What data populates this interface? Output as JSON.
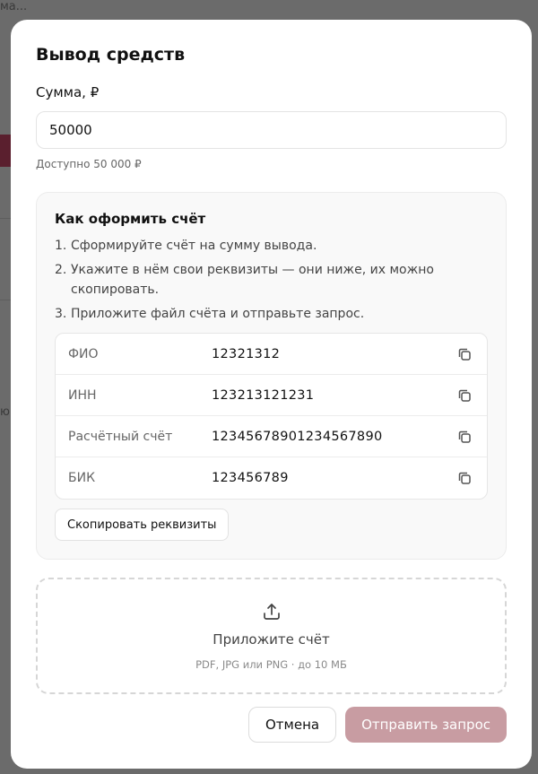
{
  "background": {
    "fragment_top": "ма...",
    "fragment_mid": "ю"
  },
  "modal": {
    "title": "Вывод средств",
    "amount": {
      "label": "Сумма, ₽",
      "value": "50000",
      "available": "Доступно 50 000 ₽"
    },
    "instructions": {
      "title": "Как оформить счёт",
      "steps": [
        {
          "num": "1.",
          "text": "Сформируйте счёт на сумму вывода."
        },
        {
          "num": "2.",
          "text": "Укажите в нём свои реквизиты — они ниже, их можно скопировать."
        },
        {
          "num": "3.",
          "text": "Приложите файл счёта и отправьте запрос."
        }
      ],
      "requisites": [
        {
          "label": "ФИО",
          "value": "12321312"
        },
        {
          "label": "ИНН",
          "value": "123213121231"
        },
        {
          "label": "Расчётный счёт",
          "value": "12345678901234567890"
        },
        {
          "label": "БИК",
          "value": "123456789"
        }
      ],
      "copy_all_label": "Скопировать реквизиты"
    },
    "upload": {
      "icon": "upload-icon",
      "title": "Приложите счёт",
      "hint": "PDF, JPG или PNG · до 10 МБ"
    },
    "actions": {
      "cancel_label": "Отмена",
      "submit_label": "Отправить запрос",
      "submit_color": "#c89ca2"
    }
  }
}
